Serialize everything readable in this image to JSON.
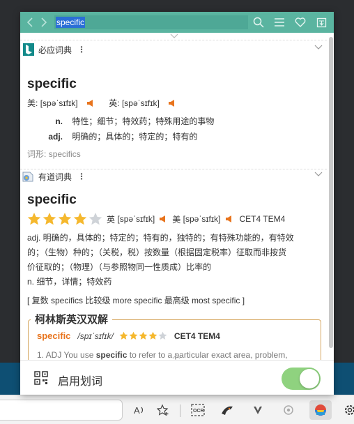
{
  "popup": {
    "search_value": "specific",
    "footer_label": "启用划词",
    "toggle_on": true,
    "accent_color": "#5ab4a0"
  },
  "bing": {
    "source": "必应词典",
    "headword": "specific",
    "us_label": "美:",
    "us_pron": "[spəˈsɪfɪk]",
    "uk_label": "英:",
    "uk_pron": "[spəˈsɪfɪk]",
    "defs": [
      {
        "pos": "n.",
        "text": "特性；细节；特效药；特殊用途的事物"
      },
      {
        "pos": "adj.",
        "text": "明确的；具体的；特定的；特有的"
      }
    ],
    "forms_label": "词形:",
    "forms_value": "specifics"
  },
  "youdao": {
    "source": "有道词典",
    "headword": "specific",
    "stars": 4,
    "stars_max": 5,
    "uk_label": "英",
    "uk_pron": "[spəˈsɪfɪk]",
    "us_label": "美",
    "us_pron": "[spəˈsɪfɪk]",
    "exams": "CET4 TEM4",
    "def_lines": [
      "adj. 明确的，具体的；特定的；特有的，独特的；有特殊功能的，有特效",
      "的；（生物）种的；（关税，税）按数量（根据固定税率）征取而非按货",
      "价征取的；（物理）（与参照物同一性质成）比率的",
      "n. 细节，详情；特效药"
    ],
    "inflections": "[ 复数 specifics 比较级 more specific 最高级 most specific ]"
  },
  "collins": {
    "title": "柯林斯英汉双解",
    "word": "specific",
    "pron": "/spɪˈsɪfɪk/",
    "stars": 4,
    "stars_max": 5,
    "exams": "CET4 TEM4",
    "example_prefix": "1. ADJ You use ",
    "example_bold": "specific",
    "example_suffix": " to refer to a particular exact area, problem,"
  },
  "colors": {
    "speaker": "#e8741d",
    "star_on": "#f5b82e",
    "star_off": "#cfd3d8",
    "collins_word": "#e8741d",
    "collins_border": "#d6a760"
  }
}
